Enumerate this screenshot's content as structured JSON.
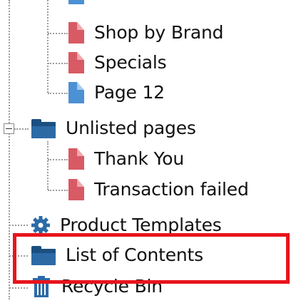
{
  "tree": {
    "items": [
      {
        "label": "",
        "icon": "page-blue-icon"
      },
      {
        "label": "Shop by Brand",
        "icon": "page-red-icon"
      },
      {
        "label": "Specials",
        "icon": "page-red-icon"
      },
      {
        "label": "Page 12",
        "icon": "page-blue-icon"
      },
      {
        "label": "Unlisted pages",
        "icon": "folder-icon",
        "expanded": true
      },
      {
        "label": "Thank You",
        "icon": "page-red-icon"
      },
      {
        "label": "Transaction failed",
        "icon": "page-red-icon"
      },
      {
        "label": "Product Templates",
        "icon": "gear-icon"
      },
      {
        "label": "List of Contents",
        "icon": "folder-icon",
        "highlighted": true
      },
      {
        "label": "Recycle Bin",
        "icon": "recycle-bin-icon"
      }
    ]
  },
  "colors": {
    "highlight_border": "#e8141c",
    "page_red": "#d85a64",
    "page_blue": "#4b91d4",
    "folder": "#2c6aa6"
  }
}
